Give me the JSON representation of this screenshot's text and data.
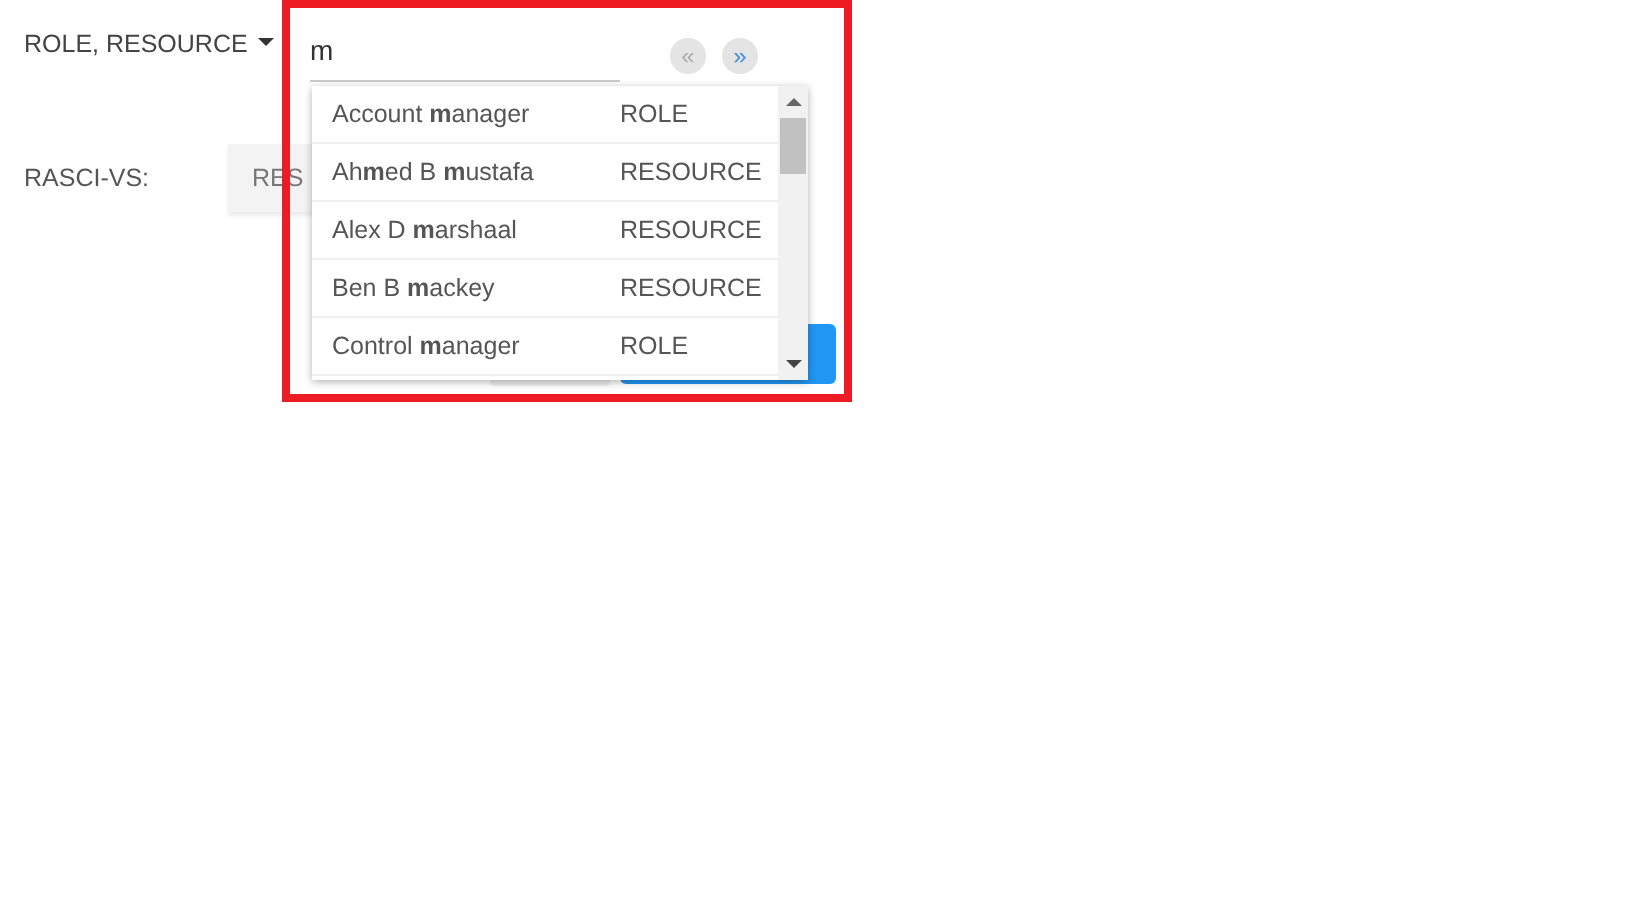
{
  "filter": {
    "label": "ROLE, RESOURCE"
  },
  "rasci": {
    "label": "RASCI-VS:",
    "value": "RES"
  },
  "search": {
    "value": "m"
  },
  "pager": [
    {
      "symbol": "«",
      "disabled": true
    },
    {
      "symbol": "»",
      "disabled": false
    }
  ],
  "suggestions": [
    {
      "name": "Account **m**anager",
      "type": "ROLE"
    },
    {
      "name": "Ah**m**ed B **m**ustafa",
      "type": "RESOURCE"
    },
    {
      "name": "Alex D **m**arshaal",
      "type": "RESOURCE"
    },
    {
      "name": "Ben B **m**ackey",
      "type": "RESOURCE"
    },
    {
      "name": "Control **m**anager",
      "type": "ROLE"
    }
  ]
}
